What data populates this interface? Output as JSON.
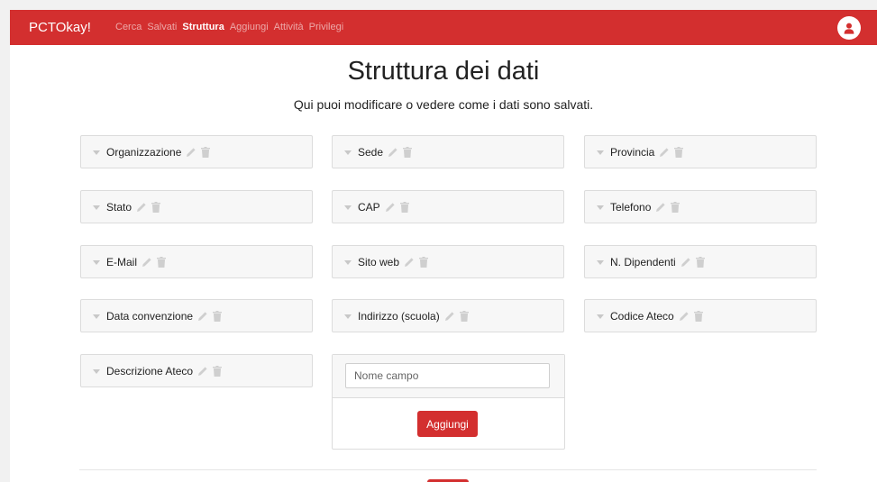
{
  "app": {
    "brand": "PCTOkay!",
    "accent": "#d32f2f"
  },
  "nav": {
    "items": [
      {
        "label": "Cerca",
        "active": false
      },
      {
        "label": "Salvati",
        "active": false
      },
      {
        "label": "Struttura",
        "active": true
      },
      {
        "label": "Aggiungi",
        "active": false
      },
      {
        "label": "Attività",
        "active": false
      },
      {
        "label": "Privilegi",
        "active": false
      }
    ],
    "user_icon": "user-icon"
  },
  "page": {
    "title": "Struttura dei dati",
    "subtitle": "Qui puoi modificare o vedere come i dati sono salvati."
  },
  "fields": [
    {
      "label": "Organizzazione"
    },
    {
      "label": "Sede"
    },
    {
      "label": "Provincia"
    },
    {
      "label": "Stato"
    },
    {
      "label": "CAP"
    },
    {
      "label": "Telefono"
    },
    {
      "label": "E-Mail"
    },
    {
      "label": "Sito web"
    },
    {
      "label": "N. Dipendenti"
    },
    {
      "label": "Data convenzione"
    },
    {
      "label": "Indirizzo (scuola)"
    },
    {
      "label": "Codice Ateco"
    },
    {
      "label": "Descrizione Ateco"
    }
  ],
  "new_field": {
    "placeholder": "Nome campo",
    "value": "",
    "button_label": "Aggiungi"
  },
  "icons": {
    "collapse": "chevron-down-icon",
    "edit": "pencil-icon",
    "delete": "trash-icon"
  }
}
